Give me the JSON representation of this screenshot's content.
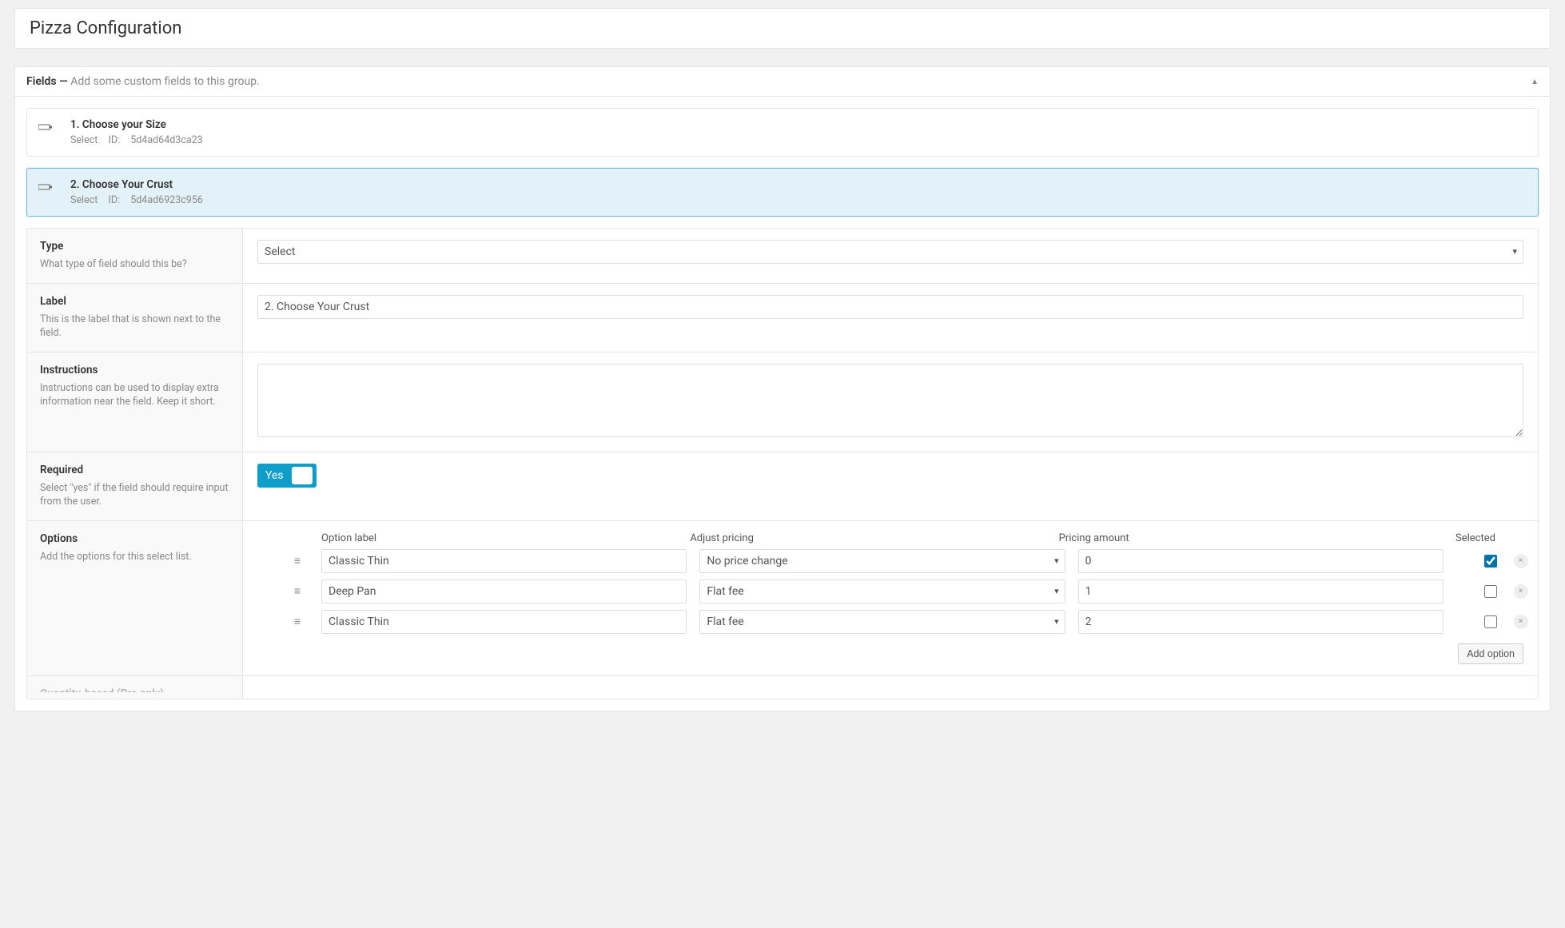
{
  "page_title": "Pizza Configuration",
  "panel": {
    "heading_bold": "Fields —",
    "heading_muted": "Add some custom fields to this group."
  },
  "fields": [
    {
      "title": "1. Choose your Size",
      "type": "Select",
      "id_label": "ID:",
      "id": "5d4ad64d3ca23",
      "active": false
    },
    {
      "title": "2. Choose Your Crust",
      "type": "Select",
      "id_label": "ID:",
      "id": "5d4ad6923c956",
      "active": true
    }
  ],
  "settings": {
    "type": {
      "label": "Type",
      "desc": "What type of field should this be?",
      "value": "Select"
    },
    "label": {
      "label": "Label",
      "desc": "This is the label that is shown next to the field.",
      "value": "2. Choose Your Crust"
    },
    "instructions": {
      "label": "Instructions",
      "desc": "Instructions can be used to display extra information near the field. Keep it short.",
      "value": ""
    },
    "required": {
      "label": "Required",
      "desc": "Select \"yes\" if the field should require input from the user.",
      "value": "Yes"
    },
    "options": {
      "label": "Options",
      "desc": "Add the options for this select list."
    },
    "quantity": {
      "label": "Quantity-based (Pro only)"
    }
  },
  "options_table": {
    "headers": {
      "option_label": "Option label",
      "adjust_pricing": "Adjust pricing",
      "pricing_amount": "Pricing amount",
      "selected": "Selected"
    },
    "rows": [
      {
        "label": "Classic Thin",
        "pricing_mode": "No price change",
        "amount": "0",
        "selected": true
      },
      {
        "label": "Deep Pan",
        "pricing_mode": "Flat fee",
        "amount": "1",
        "selected": false
      },
      {
        "label": "Classic Thin",
        "pricing_mode": "Flat fee",
        "amount": "2",
        "selected": false
      }
    ],
    "add_button": "Add option"
  }
}
